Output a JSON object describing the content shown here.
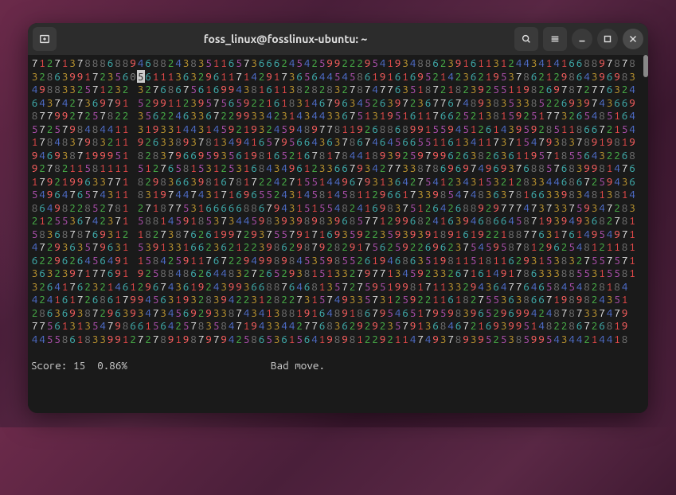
{
  "window": {
    "title": "foss_linux@fosslinux-ubuntu: ~"
  },
  "game": {
    "rows": [
      "71271378886889468824383511657366624542599222954193488623916113124434141668897878",
      "32863991723560561113632961171429173656445458619161695214236219537862129864396983",
      "4988332571232 327686756169943816113828283278747763518721823925511982697872776324",
      "6437427369791 529911239575659221618314679634526397236776748938353385226939743669",
      "8779927257822 356224633672299334231434433675131951611766252138159251773265485164",
      "5725798484411 319331443145921932459489778119268868991559451261439592851186672154",
      "1784837983211 926338937813494165795664363786746456655116134117371547938378919819",
      "9469387199951 828379669593561981652167817844189392597996263826361195718556432268",
      "9278211581111 512765815312531684349612336679342773387869697496937688576839981476",
      "1792199633771 829836639816781722427155144967931364275412343153212833446867259436",
      "5496476574311 831974474317169655243145814581129661733985474836378166339834813814",
      "8649822852781 271877531666668867943151554824169837512642688929777473733759347283",
      "2125536742371 588145918537344598393989839685771299682416394686645871939493682781",
      "5836878769312 182738762619972937557917169359223593939189161922188776317614954971",
      "4729363579631 539133166236212239862987928291756259226962375459587812962548121181",
      "6229626456491 158425911767229499898453598552619468635198115181162931538327557571",
      "3632397177691 925884862644832726529381513327977134592332671614917863338855315581",
      "3264176232146129674361924399366887646813572759519981711332943647764658454828184",
      "4241617268617994563193283942231282273157493357312592211618275536386671989824351",
      "2863693872963934734569293387434138819164891867954651795983965296994248787337479",
      "7756131354798661564257835847194334427768362929235791368467216939951482286726819",
      "4455861833991272789198797942586536156419898122921147493789395253859954344214418"
    ],
    "cursor": {
      "row": 1,
      "col": 14
    },
    "score_label": "Score:",
    "score_value": "15",
    "percent": "0.86%",
    "message": "Bad move."
  }
}
